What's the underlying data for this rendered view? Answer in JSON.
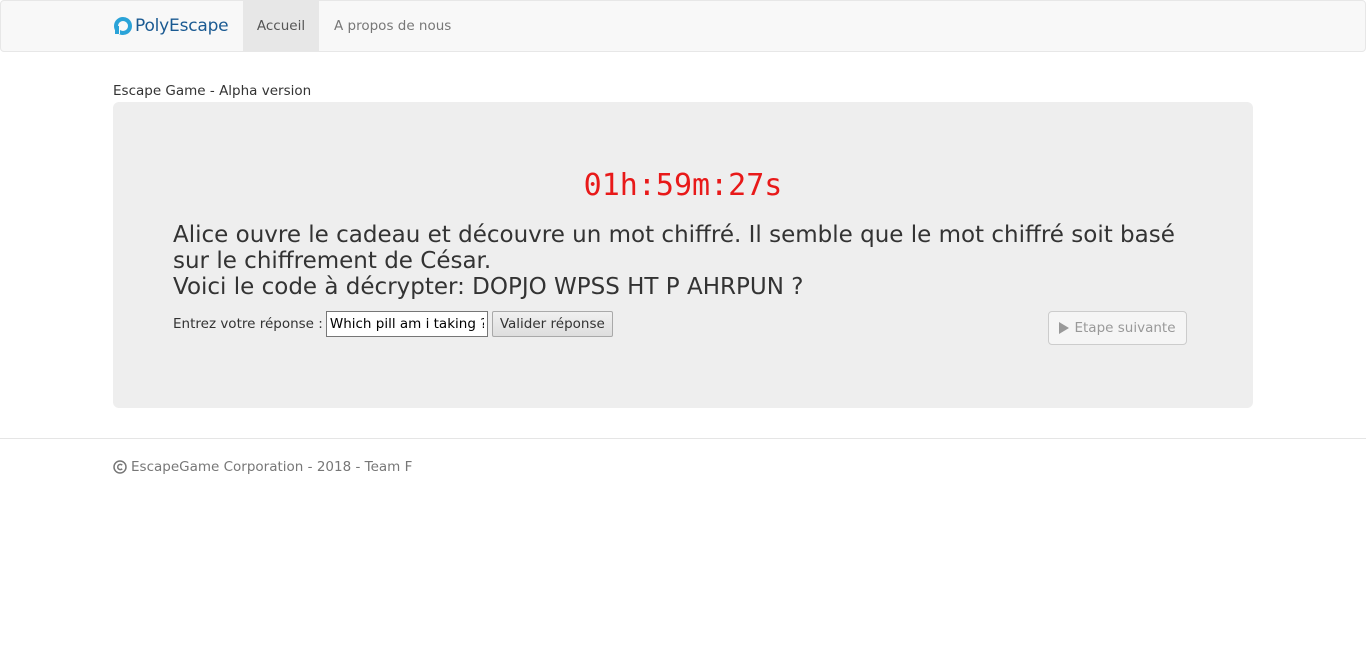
{
  "navbar": {
    "brand": "PolyEscape",
    "items": [
      {
        "label": "Accueil",
        "active": true
      },
      {
        "label": "A propos de nous",
        "active": false
      }
    ]
  },
  "page": {
    "subtitle": "Escape Game - Alpha version"
  },
  "game": {
    "timer": "01h:59m:27s",
    "timer_color": "#e81919",
    "story_line_1": "Alice ouvre le cadeau et découvre un mot chiffré. Il semble que le mot chiffré soit basé sur le chiffrement de César.",
    "story_line_2": "Voici le code à décrypter: DOPJO WPSS HT P AHRPUN ?",
    "answer_label": "Entrez votre réponse :",
    "answer_value": "Which pill am i taking ?",
    "validate_label": "Valider réponse",
    "next_label": "Etape suivante",
    "next_icon": "play-icon"
  },
  "footer": {
    "text": "EscapeGame Corporation - 2018 - Team F",
    "icon": "copyright-icon"
  },
  "colors": {
    "brand": "#1a5a92",
    "logo": "#2aa3d8",
    "panel_bg": "#eeeeee"
  }
}
